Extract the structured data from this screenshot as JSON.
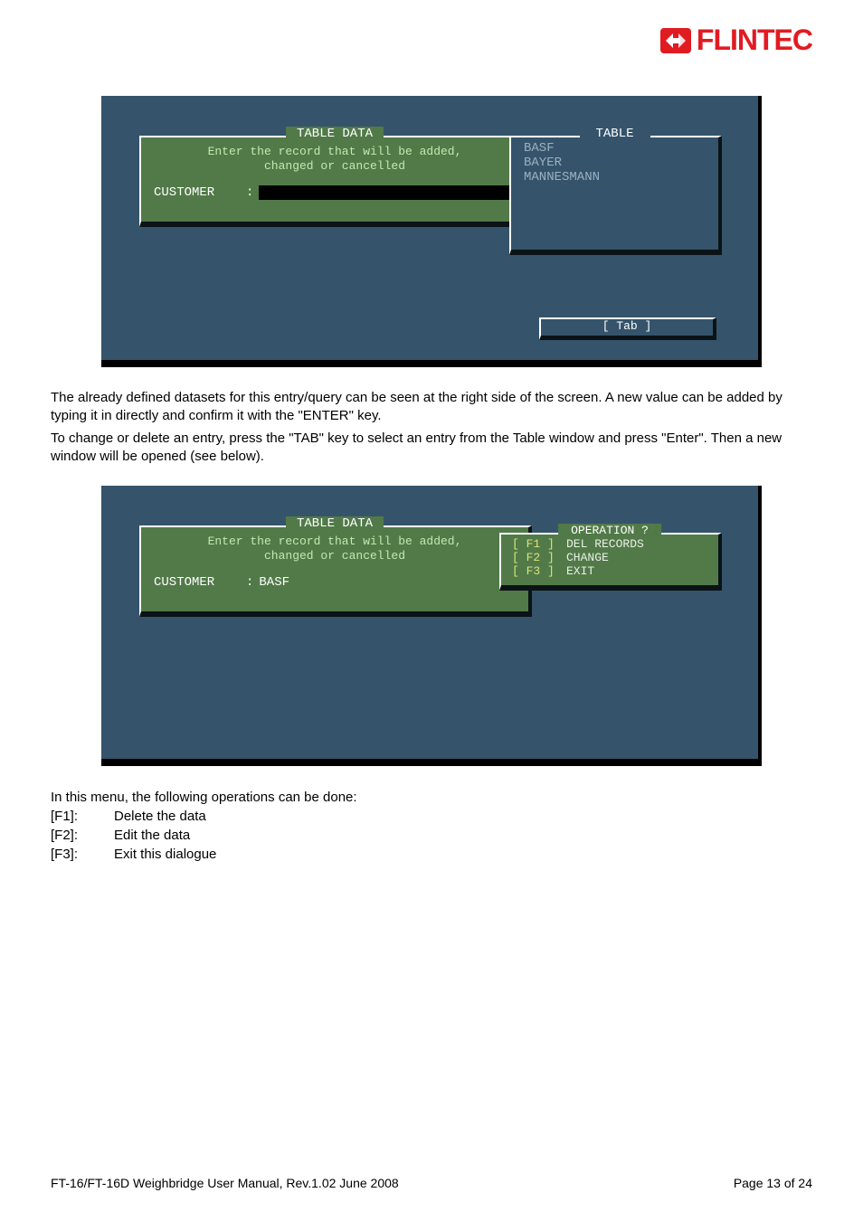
{
  "logo_text": "FLINTEC",
  "screenshot1": {
    "panel_title": "TABLE DATA",
    "hint_line1": "Enter the record that will be added,",
    "hint_line2": "changed or cancelled",
    "field_label": "CUSTOMER",
    "table_panel_title": "TABLE",
    "table_items": [
      "BASF",
      "BAYER",
      "MANNESMANN"
    ],
    "tab_label": "[ Tab ]"
  },
  "para1": "The already defined datasets for this entry/query can be seen at the right side of the screen. A new value can be added by typing it in directly and confirm it with the \"ENTER\" key.",
  "para2": "To change or delete an entry, press the \"TAB\" key to select an entry from the Table window and press \"Enter\". Then a new window will be opened (see below).",
  "screenshot2": {
    "panel_title": "TABLE DATA",
    "hint_line1": "Enter the record that will be added,",
    "hint_line2": "changed or cancelled",
    "field_label": "CUSTOMER",
    "field_value": "BASF",
    "op_panel_title": "OPERATION ?",
    "ops": [
      {
        "key": "[ F1 ]",
        "label": "DEL RECORDS"
      },
      {
        "key": "[ F2 ]",
        "label": "CHANGE"
      },
      {
        "key": "[ F3 ]",
        "label": "EXIT"
      }
    ]
  },
  "fkeys_intro": "In this menu, the following operations can be done:",
  "fkeys": [
    {
      "key": "[F1]:",
      "desc": "Delete the data"
    },
    {
      "key": "[F2]:",
      "desc": "Edit the data"
    },
    {
      "key": "[F3]:",
      "desc": "Exit this dialogue"
    }
  ],
  "footer_left": "FT-16/FT-16D Weighbridge User Manual, Rev.1.02   June 2008",
  "footer_right": "Page 13 of 24"
}
